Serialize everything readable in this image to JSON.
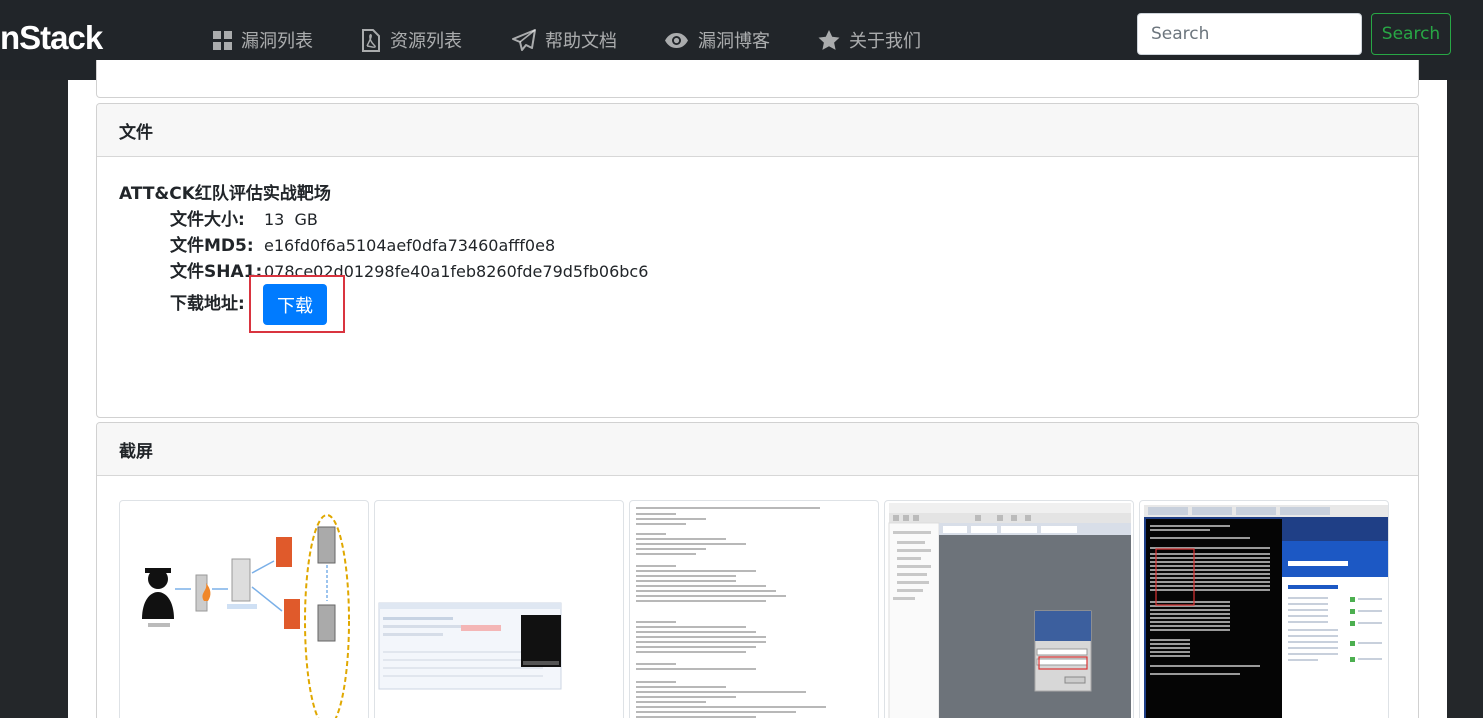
{
  "brand": {
    "text": "nStack"
  },
  "nav": {
    "items": [
      {
        "label": "漏洞列表",
        "icon": "grid-icon"
      },
      {
        "label": "资源列表",
        "icon": "file-pdf-icon"
      },
      {
        "label": "帮助文档",
        "icon": "paper-plane-icon"
      },
      {
        "label": "漏洞博客",
        "icon": "eye-icon"
      },
      {
        "label": "关于我们",
        "icon": "star-icon"
      }
    ]
  },
  "search": {
    "placeholder": "Search",
    "button_label": "Search"
  },
  "file_card": {
    "header": "文件",
    "title": "ATT&CK红队评估实战靶场",
    "rows": [
      {
        "label": "文件大小:",
        "value": "13  GB"
      },
      {
        "label": "文件MD5:",
        "value": "e16fd0f6a5104aef0dfa73460afff0e8"
      },
      {
        "label": "文件SHA1:",
        "value": "078ce02d01298fe40a1feb8260fde79d5fb06bc6"
      }
    ],
    "download_label": "下载地址:",
    "download_button": "下载"
  },
  "screens_card": {
    "header": "截屏"
  },
  "colors": {
    "navbar": "#212529",
    "primary": "#007bff",
    "success": "#28a745",
    "highlight": "#d9343f"
  }
}
